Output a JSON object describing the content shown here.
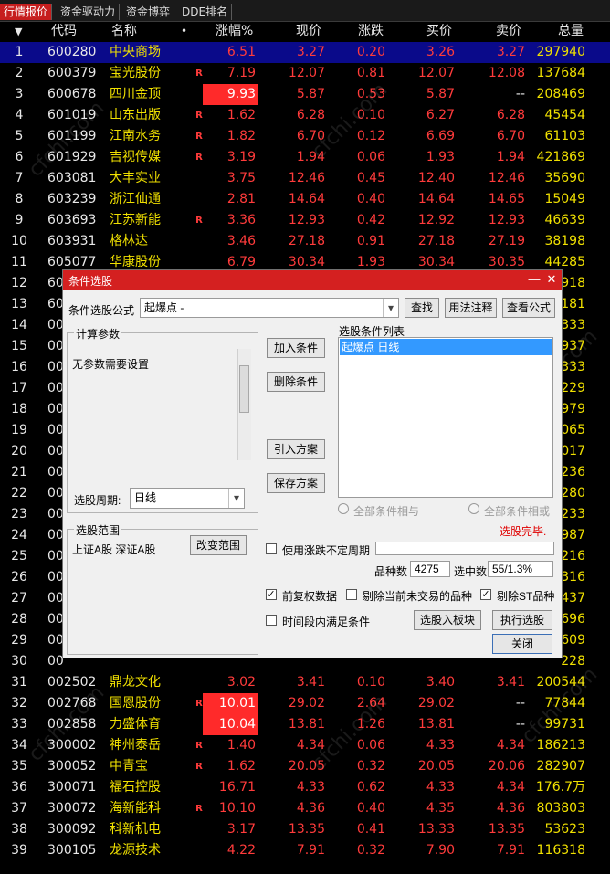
{
  "tabs": [
    "行情报价",
    "资金驱动力",
    "资金博弈",
    "DDE排名"
  ],
  "header": {
    "sort_arrow": "▼",
    "code": "代码",
    "name": "名称",
    "dot": "•",
    "pct": "涨幅%",
    "price": "现价",
    "chg": "涨跌",
    "buy": "买价",
    "sell": "卖价",
    "vol": "总量"
  },
  "rows": [
    {
      "idx": "1",
      "code": "600280",
      "name": "中央商场",
      "r": "",
      "pct": "6.51",
      "price": "3.27",
      "chg": "0.20",
      "buy": "3.26",
      "sell": "3.27",
      "vol": "297940"
    },
    {
      "idx": "2",
      "code": "600379",
      "name": "宝光股份",
      "r": "R",
      "pct": "7.19",
      "price": "12.07",
      "chg": "0.81",
      "buy": "12.07",
      "sell": "12.08",
      "vol": "137684"
    },
    {
      "idx": "3",
      "code": "600678",
      "name": "四川金顶",
      "r": "",
      "pct": "9.93",
      "price": "5.87",
      "chg": "0.53",
      "buy": "5.87",
      "sell": "--",
      "vol": "208469"
    },
    {
      "idx": "4",
      "code": "601019",
      "name": "山东出版",
      "r": "R",
      "pct": "1.62",
      "price": "6.28",
      "chg": "0.10",
      "buy": "6.27",
      "sell": "6.28",
      "vol": "45454"
    },
    {
      "idx": "5",
      "code": "601199",
      "name": "江南水务",
      "r": "R",
      "pct": "1.82",
      "price": "6.70",
      "chg": "0.12",
      "buy": "6.69",
      "sell": "6.70",
      "vol": "61103"
    },
    {
      "idx": "6",
      "code": "601929",
      "name": "吉视传媒",
      "r": "R",
      "pct": "3.19",
      "price": "1.94",
      "chg": "0.06",
      "buy": "1.93",
      "sell": "1.94",
      "vol": "421869"
    },
    {
      "idx": "7",
      "code": "603081",
      "name": "大丰实业",
      "r": "",
      "pct": "3.75",
      "price": "12.46",
      "chg": "0.45",
      "buy": "12.40",
      "sell": "12.46",
      "vol": "35690"
    },
    {
      "idx": "8",
      "code": "603239",
      "name": "浙江仙通",
      "r": "",
      "pct": "2.81",
      "price": "14.64",
      "chg": "0.40",
      "buy": "14.64",
      "sell": "14.65",
      "vol": "15049"
    },
    {
      "idx": "9",
      "code": "603693",
      "name": "江苏新能",
      "r": "R",
      "pct": "3.36",
      "price": "12.93",
      "chg": "0.42",
      "buy": "12.92",
      "sell": "12.93",
      "vol": "46639"
    },
    {
      "idx": "10",
      "code": "603931",
      "name": "格林达",
      "r": "",
      "pct": "3.46",
      "price": "27.18",
      "chg": "0.91",
      "buy": "27.18",
      "sell": "27.19",
      "vol": "38198"
    },
    {
      "idx": "11",
      "code": "605077",
      "name": "华康股份",
      "r": "",
      "pct": "6.79",
      "price": "30.34",
      "chg": "1.93",
      "buy": "30.34",
      "sell": "30.35",
      "vol": "44285"
    },
    {
      "idx": "12",
      "code": "60",
      "name": "",
      "r": "",
      "pct": "",
      "price": "",
      "chg": "",
      "buy": "",
      "sell": "",
      "vol": "918"
    },
    {
      "idx": "13",
      "code": "60",
      "name": "",
      "r": "",
      "pct": "",
      "price": "",
      "chg": "",
      "buy": "",
      "sell": "",
      "vol": "181"
    },
    {
      "idx": "14",
      "code": "00",
      "name": "",
      "r": "",
      "pct": "",
      "price": "",
      "chg": "",
      "buy": "",
      "sell": "",
      "vol": "333"
    },
    {
      "idx": "15",
      "code": "00",
      "name": "",
      "r": "",
      "pct": "",
      "price": "",
      "chg": "",
      "buy": "",
      "sell": "",
      "vol": "937"
    },
    {
      "idx": "16",
      "code": "00",
      "name": "",
      "r": "",
      "pct": "",
      "price": "",
      "chg": "",
      "buy": "",
      "sell": "",
      "vol": "333"
    },
    {
      "idx": "17",
      "code": "00",
      "name": "",
      "r": "",
      "pct": "",
      "price": "",
      "chg": "",
      "buy": "",
      "sell": "",
      "vol": "229"
    },
    {
      "idx": "18",
      "code": "00",
      "name": "",
      "r": "",
      "pct": "",
      "price": "",
      "chg": "",
      "buy": "",
      "sell": "",
      "vol": "979"
    },
    {
      "idx": "19",
      "code": "00",
      "name": "",
      "r": "",
      "pct": "",
      "price": "",
      "chg": "",
      "buy": "",
      "sell": "",
      "vol": "065"
    },
    {
      "idx": "20",
      "code": "00",
      "name": "",
      "r": "",
      "pct": "",
      "price": "",
      "chg": "",
      "buy": "",
      "sell": "",
      "vol": "017"
    },
    {
      "idx": "21",
      "code": "00",
      "name": "",
      "r": "",
      "pct": "",
      "price": "",
      "chg": "",
      "buy": "",
      "sell": "",
      "vol": "236"
    },
    {
      "idx": "22",
      "code": "00",
      "name": "",
      "r": "",
      "pct": "",
      "price": "",
      "chg": "",
      "buy": "",
      "sell": "",
      "vol": "280"
    },
    {
      "idx": "23",
      "code": "00",
      "name": "",
      "r": "",
      "pct": "",
      "price": "",
      "chg": "",
      "buy": "",
      "sell": "",
      "vol": "233"
    },
    {
      "idx": "24",
      "code": "00",
      "name": "",
      "r": "",
      "pct": "",
      "price": "",
      "chg": "",
      "buy": "",
      "sell": "",
      "vol": "987"
    },
    {
      "idx": "25",
      "code": "00",
      "name": "",
      "r": "",
      "pct": "",
      "price": "",
      "chg": "",
      "buy": "",
      "sell": "",
      "vol": "216"
    },
    {
      "idx": "26",
      "code": "00",
      "name": "",
      "r": "",
      "pct": "",
      "price": "",
      "chg": "",
      "buy": "",
      "sell": "",
      "vol": "316"
    },
    {
      "idx": "27",
      "code": "00",
      "name": "",
      "r": "",
      "pct": "",
      "price": "",
      "chg": "",
      "buy": "",
      "sell": "",
      "vol": "437"
    },
    {
      "idx": "28",
      "code": "00",
      "name": "",
      "r": "",
      "pct": "",
      "price": "",
      "chg": "",
      "buy": "",
      "sell": "",
      "vol": "696"
    },
    {
      "idx": "29",
      "code": "00",
      "name": "",
      "r": "",
      "pct": "",
      "price": "",
      "chg": "",
      "buy": "",
      "sell": "",
      "vol": "609"
    },
    {
      "idx": "30",
      "code": "00",
      "name": "",
      "r": "",
      "pct": "",
      "price": "",
      "chg": "",
      "buy": "",
      "sell": "",
      "vol": "228"
    },
    {
      "idx": "31",
      "code": "002502",
      "name": "鼎龙文化",
      "r": "",
      "pct": "3.02",
      "price": "3.41",
      "chg": "0.10",
      "buy": "3.40",
      "sell": "3.41",
      "vol": "200544"
    },
    {
      "idx": "32",
      "code": "002768",
      "name": "国恩股份",
      "r": "R",
      "pct": "10.01",
      "price": "29.02",
      "chg": "2.64",
      "buy": "29.02",
      "sell": "--",
      "vol": "77844"
    },
    {
      "idx": "33",
      "code": "002858",
      "name": "力盛体育",
      "r": "",
      "pct": "10.04",
      "price": "13.81",
      "chg": "1.26",
      "buy": "13.81",
      "sell": "--",
      "vol": "99731"
    },
    {
      "idx": "34",
      "code": "300002",
      "name": "神州泰岳",
      "r": "R",
      "pct": "1.40",
      "price": "4.34",
      "chg": "0.06",
      "buy": "4.33",
      "sell": "4.34",
      "vol": "186213"
    },
    {
      "idx": "35",
      "code": "300052",
      "name": "中青宝",
      "r": "R",
      "pct": "1.62",
      "price": "20.05",
      "chg": "0.32",
      "buy": "20.05",
      "sell": "20.06",
      "vol": "282907"
    },
    {
      "idx": "36",
      "code": "300071",
      "name": "福石控股",
      "r": "",
      "pct": "16.71",
      "price": "4.33",
      "chg": "0.62",
      "buy": "4.33",
      "sell": "4.34",
      "vol": "176.7万"
    },
    {
      "idx": "37",
      "code": "300072",
      "name": "海新能科",
      "r": "R",
      "pct": "10.10",
      "price": "4.36",
      "chg": "0.40",
      "buy": "4.35",
      "sell": "4.36",
      "vol": "803803"
    },
    {
      "idx": "38",
      "code": "300092",
      "name": "科新机电",
      "r": "",
      "pct": "3.17",
      "price": "13.35",
      "chg": "0.41",
      "buy": "13.33",
      "sell": "13.35",
      "vol": "53623"
    },
    {
      "idx": "39",
      "code": "300105",
      "name": "龙源技术",
      "r": "",
      "pct": "4.22",
      "price": "7.91",
      "chg": "0.32",
      "buy": "7.90",
      "sell": "7.91",
      "vol": "116318"
    }
  ],
  "dialog": {
    "title": "条件选股",
    "formula_label": "条件选股公式",
    "formula_value": "起爆点    -",
    "btn_search": "查找",
    "btn_usage": "用法注释",
    "btn_view": "查看公式",
    "params_group": "计算参数",
    "params_text": "无参数需要设置",
    "period_label": "选股周期:",
    "period_value": "日线",
    "scope_group": "选股范围",
    "scope_text": "上证A股 深证A股",
    "btn_change_scope": "改变范围",
    "btn_add": "加入条件",
    "btn_delete": "删除条件",
    "btn_import": "引入方案",
    "btn_save": "保存方案",
    "list_label": "选股条件列表",
    "list_item": "起爆点  日线",
    "radio_and": "全部条件相与",
    "radio_or": "全部条件相或",
    "status": "选股完毕.",
    "chk_var_period": "使用涨跌不定周期",
    "count_label": "品种数",
    "count_value": "4275",
    "selected_label": "选中数",
    "selected_value": "55/1.3%",
    "chk_adjust": "前复权数据",
    "chk_exclude_untrade": "剔除当前未交易的品种",
    "chk_exclude_st": "剔除ST品种",
    "chk_time_range": "时间段内满足条件",
    "btn_to_sector": "选股入板块",
    "btn_execute": "执行选股",
    "btn_close": "关闭",
    "title_min": "—",
    "title_close": "✕",
    "check_mark": "✓",
    "combo_arrow": "▾"
  },
  "watermark": "cfchi.com",
  "colors": {
    "up": "#ff3b3b",
    "name": "#f0e000",
    "tab_active": "#c61e1e",
    "dialog_title": "#d42020",
    "selected_row": "#0a0a8a"
  }
}
